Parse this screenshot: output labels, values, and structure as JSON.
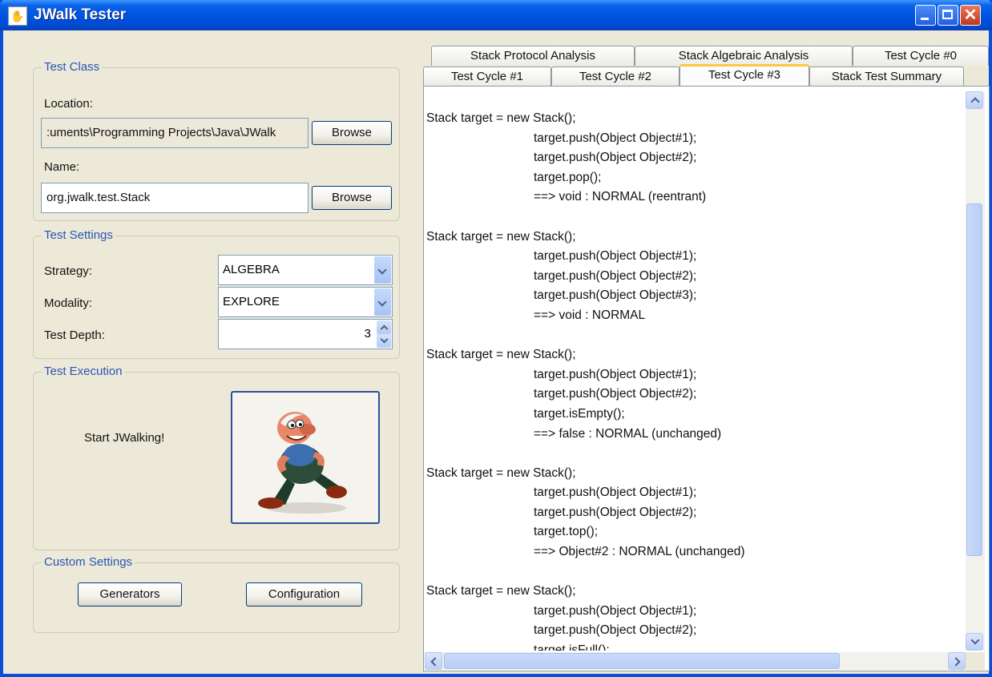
{
  "window": {
    "title": "JWalk Tester",
    "app_icon": "jwalk-app-icon"
  },
  "test_class": {
    "legend": "Test Class",
    "location_label": "Location:",
    "location_value": ":uments\\Programming Projects\\Java\\JWalk",
    "browse_label": "Browse",
    "name_label": "Name:",
    "name_value": "org.jwalk.test.Stack"
  },
  "test_settings": {
    "legend": "Test Settings",
    "strategy_label": "Strategy:",
    "strategy_value": "ALGEBRA",
    "modality_label": "Modality:",
    "modality_value": "EXPLORE",
    "depth_label": "Test Depth:",
    "depth_value": "3"
  },
  "test_execution": {
    "legend": "Test Execution",
    "start_label": "Start JWalking!",
    "image_icon": "jwalker-cartoon-icon"
  },
  "custom_settings": {
    "legend": "Custom Settings",
    "generators_label": "Generators",
    "configuration_label": "Configuration"
  },
  "tabs": {
    "row1": [
      "Stack Protocol Analysis",
      "Stack Algebraic Analysis",
      "Test Cycle #0"
    ],
    "row2": [
      "Test Cycle #1",
      "Test Cycle #2",
      "Test Cycle #3",
      "Stack Test Summary"
    ],
    "active": "Test Cycle #3"
  },
  "output_lines": [
    {
      "t": "Stack target = new Stack();",
      "i": false
    },
    {
      "t": "target.push(Object Object#1);",
      "i": true
    },
    {
      "t": "target.push(Object Object#2);",
      "i": true
    },
    {
      "t": "target.pop();",
      "i": true
    },
    {
      "t": "==> void : NORMAL (reentrant)",
      "i": true
    },
    {
      "t": "",
      "i": false
    },
    {
      "t": "Stack target = new Stack();",
      "i": false
    },
    {
      "t": "target.push(Object Object#1);",
      "i": true
    },
    {
      "t": "target.push(Object Object#2);",
      "i": true
    },
    {
      "t": "target.push(Object Object#3);",
      "i": true
    },
    {
      "t": "==> void : NORMAL",
      "i": true
    },
    {
      "t": "",
      "i": false
    },
    {
      "t": "Stack target = new Stack();",
      "i": false
    },
    {
      "t": "target.push(Object Object#1);",
      "i": true
    },
    {
      "t": "target.push(Object Object#2);",
      "i": true
    },
    {
      "t": "target.isEmpty();",
      "i": true
    },
    {
      "t": "==> false : NORMAL (unchanged)",
      "i": true
    },
    {
      "t": "",
      "i": false
    },
    {
      "t": "Stack target = new Stack();",
      "i": false
    },
    {
      "t": "target.push(Object Object#1);",
      "i": true
    },
    {
      "t": "target.push(Object Object#2);",
      "i": true
    },
    {
      "t": "target.top();",
      "i": true
    },
    {
      "t": "==> Object#2 : NORMAL (unchanged)",
      "i": true
    },
    {
      "t": "",
      "i": false
    },
    {
      "t": "Stack target = new Stack();",
      "i": false
    },
    {
      "t": "target.push(Object Object#1);",
      "i": true
    },
    {
      "t": "target.push(Object Object#2);",
      "i": true
    },
    {
      "t": "target.isFull();",
      "i": true
    }
  ]
}
